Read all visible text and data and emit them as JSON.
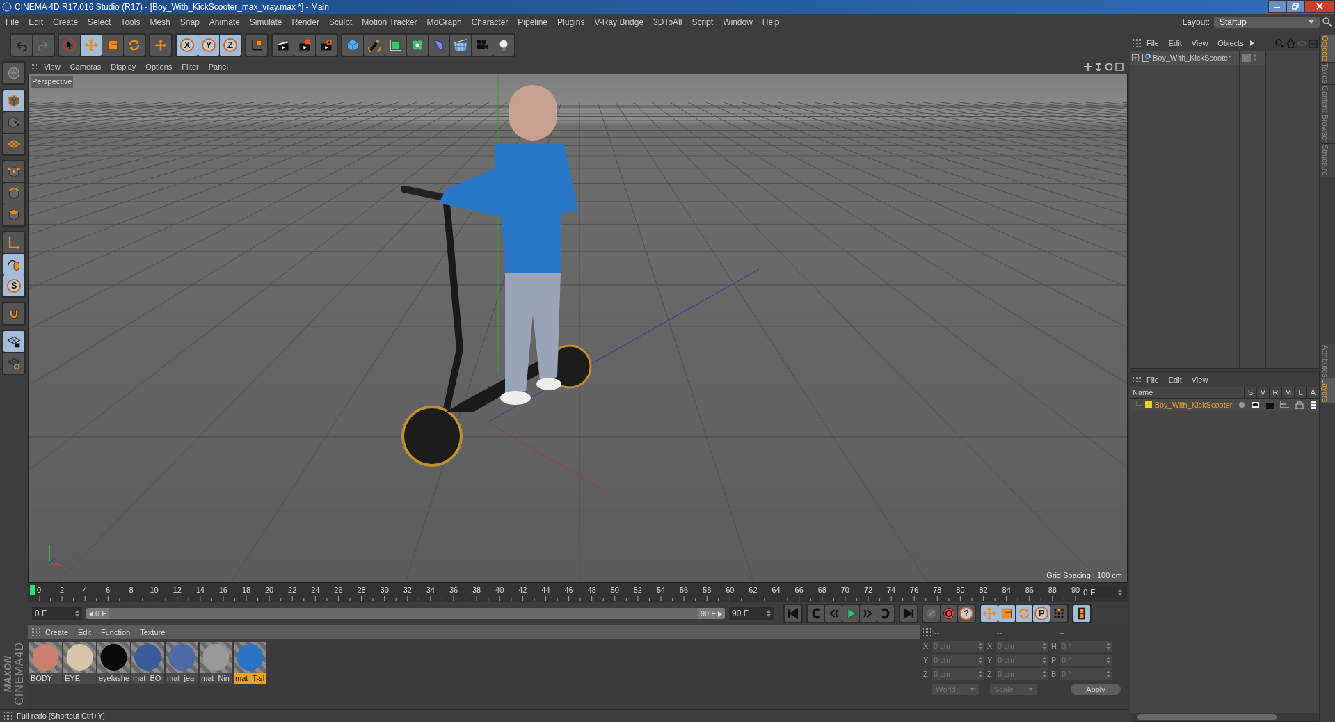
{
  "window": {
    "title": "CINEMA 4D R17.016 Studio (R17) - [Boy_With_KickScooter_max_vray.max *] - Main"
  },
  "menu_bar": [
    "File",
    "Edit",
    "Create",
    "Select",
    "Tools",
    "Mesh",
    "Snap",
    "Animate",
    "Simulate",
    "Render",
    "Sculpt",
    "Motion Tracker",
    "MoGraph",
    "Character",
    "Pipeline",
    "Plugins",
    "V-Ray Bridge",
    "3DToAll",
    "Script",
    "Window",
    "Help"
  ],
  "layout": {
    "label": "Layout:",
    "value": "Startup"
  },
  "toolbar": [
    [
      {
        "selected": false
      },
      {
        "selected": false
      }
    ],
    [
      {
        "selected": false
      },
      {
        "selected": true
      },
      {
        "selected": false
      },
      {
        "selected": false
      }
    ],
    [
      {
        "selected": false
      }
    ],
    [
      {
        "label": "X",
        "selected": true
      },
      {
        "label": "Y",
        "selected": true
      },
      {
        "label": "Z",
        "selected": true
      }
    ],
    [
      {
        "selected": false
      }
    ],
    [
      {
        "selected": false
      },
      {
        "selected": false
      },
      {
        "selected": false
      }
    ],
    [
      {
        "selected": false
      },
      {
        "selected": false
      },
      {
        "selected": false
      },
      {
        "selected": false
      },
      {
        "selected": false
      },
      {
        "selected": false
      },
      {
        "selected": false
      },
      {
        "selected": false
      }
    ]
  ],
  "left_tools": [
    [
      {
        "selected": false
      }
    ],
    [
      {
        "selected": true
      },
      {
        "selected": false
      },
      {
        "selected": false
      }
    ],
    [
      {
        "selected": false
      },
      {
        "selected": false
      },
      {
        "selected": false
      }
    ],
    [
      {
        "selected": false
      },
      {
        "selected": true
      },
      {
        "label": "S",
        "selected": true
      }
    ],
    [
      {
        "selected": false
      }
    ],
    [
      {
        "selected": true
      },
      {
        "selected": false
      }
    ]
  ],
  "viewport": {
    "menu": [
      "View",
      "Cameras",
      "Display",
      "Options",
      "Filter",
      "Panel"
    ],
    "camera": "Perspective",
    "grid_spacing": "Grid Spacing : 100 cm"
  },
  "timeline": {
    "ticks": [
      "0",
      "2",
      "4",
      "6",
      "8",
      "10",
      "12",
      "14",
      "16",
      "18",
      "20",
      "22",
      "24",
      "26",
      "28",
      "30",
      "32",
      "34",
      "36",
      "38",
      "40",
      "42",
      "44",
      "46",
      "48",
      "50",
      "52",
      "54",
      "56",
      "58",
      "60",
      "62",
      "64",
      "66",
      "68",
      "70",
      "72",
      "74",
      "76",
      "78",
      "80",
      "82",
      "84",
      "86",
      "88",
      "90"
    ],
    "current_frame": "0 F",
    "start_field": "0 F",
    "range_start": "0 F",
    "range_end": "90 F",
    "range_slider": {
      "level": 1
    },
    "end_field": "90 F"
  },
  "transport": [
    [
      {
        "selected": false
      }
    ],
    [
      {
        "selected": false
      },
      {
        "selected": false
      },
      {
        "selected": false
      },
      {
        "selected": false
      },
      {
        "selected": false
      }
    ],
    [
      {
        "selected": false
      }
    ],
    [
      {
        "selected": false
      },
      {
        "selected": false
      },
      {
        "label": "?",
        "selected": false
      }
    ],
    [
      {
        "selected": true
      },
      {
        "selected": true
      },
      {
        "selected": true
      },
      {
        "label": "P",
        "selected": true
      },
      {
        "selected": false
      }
    ],
    [
      {
        "selected": true
      }
    ]
  ],
  "material_manager": {
    "menu": [
      "Create",
      "Edit",
      "Function",
      "Texture"
    ],
    "materials": [
      {
        "name": "BODY",
        "color": "#c9806e",
        "selected": false
      },
      {
        "name": "EYE",
        "color": "#d8c4a8",
        "selected": false
      },
      {
        "name": "eyelashe",
        "color": "#0a0a0a",
        "selected": false
      },
      {
        "name": "mat_BO",
        "color": "#3a5a9a",
        "selected": false
      },
      {
        "name": "mat_jeai",
        "color": "#4d6aa5",
        "selected": false
      },
      {
        "name": "mat_Nin",
        "color": "#9a9a9a",
        "selected": false
      },
      {
        "name": "mat_T-sl",
        "color": "#2a72c4",
        "selected": true
      }
    ]
  },
  "coordinates": {
    "headers": [
      "--",
      "--",
      "--"
    ],
    "rows": [
      [
        {
          "axis": "X",
          "value": "0 cm"
        },
        {
          "axis": "X",
          "value": "0 cm"
        },
        {
          "axis": "H",
          "value": "0 °"
        }
      ],
      [
        {
          "axis": "Y",
          "value": "0 cm"
        },
        {
          "axis": "Y",
          "value": "0 cm"
        },
        {
          "axis": "P",
          "value": "0 °"
        }
      ],
      [
        {
          "axis": "Z",
          "value": "0 cm"
        },
        {
          "axis": "Z",
          "value": "0 cm"
        },
        {
          "axis": "B",
          "value": "0 °"
        }
      ]
    ],
    "dropdowns": [
      "World",
      "Scale"
    ],
    "apply": "Apply"
  },
  "brand": {
    "company": "MAXON",
    "product": "CINEMA4D"
  },
  "status_bar": "Full redo [Shortcut Ctrl+Y]",
  "objects_panel": {
    "menu": [
      "File",
      "Edit",
      "View",
      "Objects"
    ],
    "objects": [
      {
        "name": "Boy_With_KickScooter"
      }
    ]
  },
  "layers_panel": {
    "menu": [
      "File",
      "Edit",
      "View"
    ],
    "columns": [
      "Name",
      "S",
      "V",
      "R",
      "M",
      "L",
      "A"
    ],
    "layers": [
      {
        "name": "Boy_With_KickScooter",
        "color": "#e8d420"
      }
    ]
  },
  "side_tabs_top": [
    {
      "label": "Objects",
      "selected": true
    },
    {
      "label": "Takes",
      "selected": false
    },
    {
      "label": "Content Browser",
      "selected": false
    },
    {
      "label": "Structure",
      "selected": false
    }
  ],
  "side_tabs_bottom": [
    {
      "label": "Attributes",
      "selected": false
    },
    {
      "label": "Layers",
      "selected": true
    }
  ]
}
